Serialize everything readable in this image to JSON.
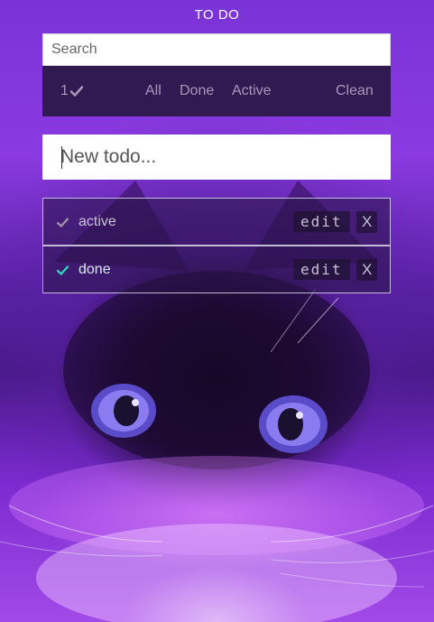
{
  "app": {
    "title": "TO DO"
  },
  "search": {
    "placeholder": "Search"
  },
  "filters": {
    "count": "1",
    "all": "All",
    "done": "Done",
    "active": "Active",
    "clean": "Clean"
  },
  "new_todo": {
    "placeholder": "New todo..."
  },
  "todos": [
    {
      "label": "active",
      "done": false,
      "edit_label": "edit",
      "delete_label": "X"
    },
    {
      "label": "done",
      "done": true,
      "edit_label": "edit",
      "delete_label": "X"
    }
  ],
  "colors": {
    "background": "#7a2fd8",
    "panel": "#26163e",
    "done_check": "#2fd4b8",
    "active_check": "#9a93a6"
  }
}
